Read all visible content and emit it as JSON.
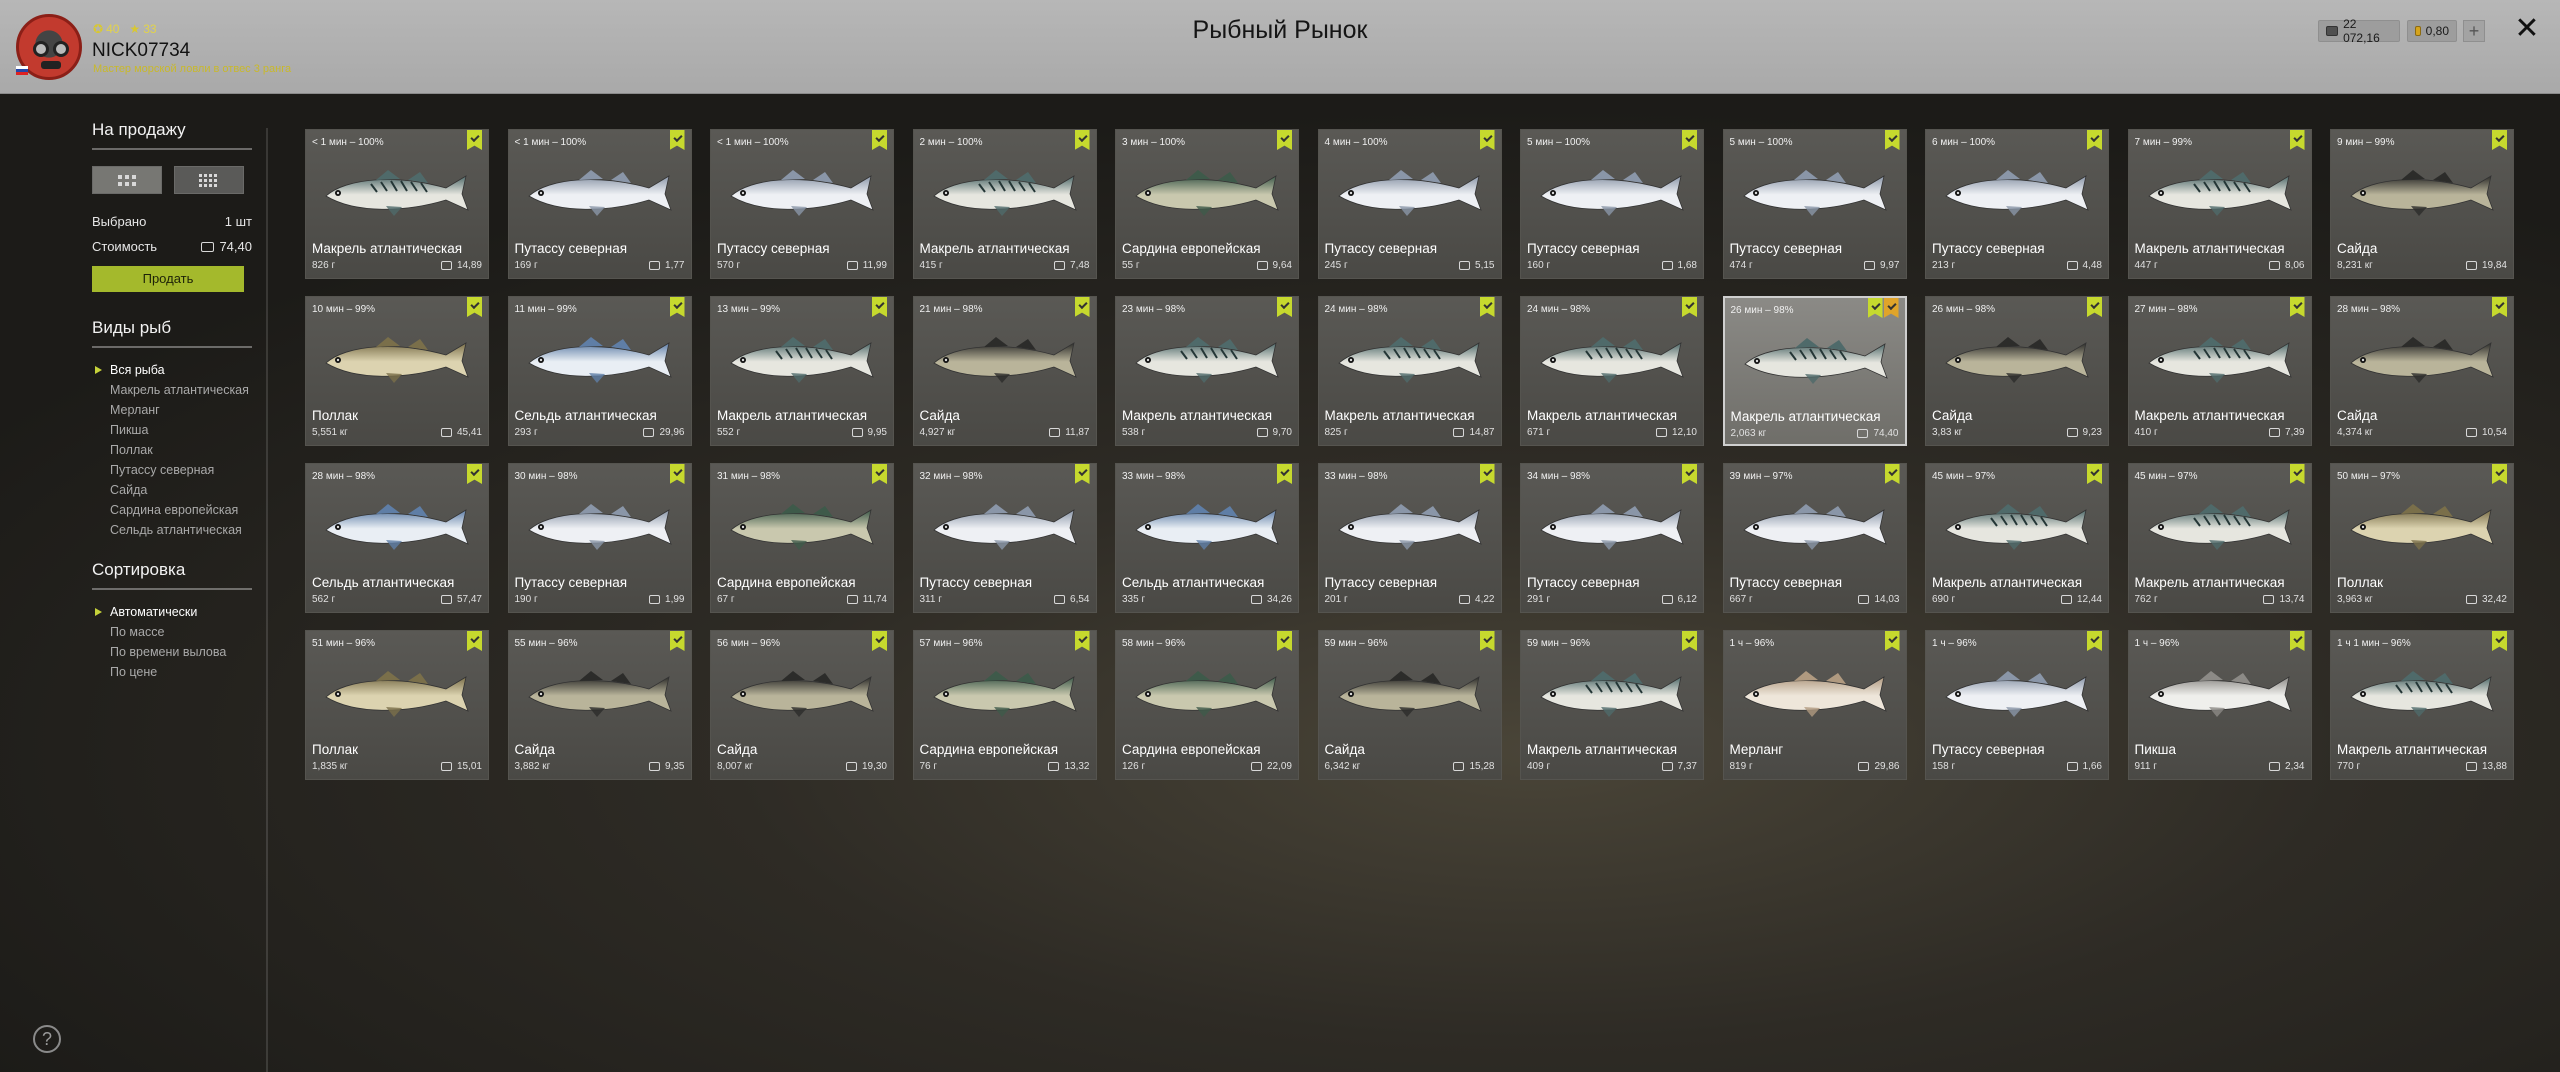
{
  "header": {
    "title": "Рыбный Рынок",
    "nick": "NICK07734",
    "rank": "Мастер морской ловли в отвес 3 ранга",
    "stat_level": "40",
    "stat_stars": "33",
    "silver": "22 072,16",
    "gold": "0,80",
    "plus": "+",
    "close": "✕"
  },
  "sidebar": {
    "sale_title": "На продажу",
    "selected_label": "Выбрано",
    "selected_value": "1 шт",
    "cost_label": "Стоимость",
    "cost_value": "74,40",
    "sell_button": "Продать",
    "species_title": "Виды рыб",
    "species": [
      "Вся рыба",
      "Макрель атлантическая",
      "Мерланг",
      "Пикша",
      "Поллак",
      "Путассу северная",
      "Сайда",
      "Сардина европейская",
      "Сельдь атлантическая"
    ],
    "species_selected": 0,
    "sort_title": "Сортировка",
    "sort": [
      "Автоматически",
      "По массе",
      "По времени вылова",
      "По цене"
    ],
    "sort_selected": 0
  },
  "help": "?",
  "colors": {
    "accent": "#a4b92c",
    "flag": "#c6d92e",
    "header": "#b0b0b0"
  },
  "fish": [
    {
      "time": "< 1 мин – 100%",
      "name": "Макрель атлантическая",
      "weight": "826 г",
      "price": "14,89",
      "kind": "mackerel"
    },
    {
      "time": "< 1 мин – 100%",
      "name": "Путассу северная",
      "weight": "169 г",
      "price": "1,77",
      "kind": "whiting"
    },
    {
      "time": "< 1 мин – 100%",
      "name": "Путассу северная",
      "weight": "570 г",
      "price": "11,99",
      "kind": "whiting"
    },
    {
      "time": "2 мин – 100%",
      "name": "Макрель атлантическая",
      "weight": "415 г",
      "price": "7,48",
      "kind": "mackerel"
    },
    {
      "time": "3 мин – 100%",
      "name": "Сардина европейская",
      "weight": "55 г",
      "price": "9,64",
      "kind": "sardine"
    },
    {
      "time": "4 мин – 100%",
      "name": "Путассу северная",
      "weight": "245 г",
      "price": "5,15",
      "kind": "whiting"
    },
    {
      "time": "5 мин – 100%",
      "name": "Путассу северная",
      "weight": "160 г",
      "price": "1,68",
      "kind": "whiting"
    },
    {
      "time": "5 мин – 100%",
      "name": "Путассу северная",
      "weight": "474 г",
      "price": "9,97",
      "kind": "whiting"
    },
    {
      "time": "6 мин – 100%",
      "name": "Путассу северная",
      "weight": "213 г",
      "price": "4,48",
      "kind": "whiting"
    },
    {
      "time": "7 мин – 99%",
      "name": "Макрель атлантическая",
      "weight": "447 г",
      "price": "8,06",
      "kind": "mackerel"
    },
    {
      "time": "9 мин – 99%",
      "name": "Сайда",
      "weight": "8,231 кг",
      "price": "19,84",
      "kind": "saithe"
    },
    {
      "time": "10 мин – 99%",
      "name": "Поллак",
      "weight": "5,551 кг",
      "price": "45,41",
      "kind": "pollack"
    },
    {
      "time": "11 мин – 99%",
      "name": "Сельдь атлантическая",
      "weight": "293 г",
      "price": "29,96",
      "kind": "herring"
    },
    {
      "time": "13 мин – 99%",
      "name": "Макрель атлантическая",
      "weight": "552 г",
      "price": "9,95",
      "kind": "mackerel"
    },
    {
      "time": "21 мин – 98%",
      "name": "Сайда",
      "weight": "4,927 кг",
      "price": "11,87",
      "kind": "saithe"
    },
    {
      "time": "23 мин – 98%",
      "name": "Макрель атлантическая",
      "weight": "538 г",
      "price": "9,70",
      "kind": "mackerel"
    },
    {
      "time": "24 мин – 98%",
      "name": "Макрель атлантическая",
      "weight": "825 г",
      "price": "14,87",
      "kind": "mackerel"
    },
    {
      "time": "24 мин – 98%",
      "name": "Макрель атлантическая",
      "weight": "671 г",
      "price": "12,10",
      "kind": "mackerel"
    },
    {
      "time": "26 мин – 98%",
      "name": "Макрель атлантическая",
      "weight": "2,063 кг",
      "price": "74,40",
      "kind": "mackerel",
      "selected": true
    },
    {
      "time": "26 мин – 98%",
      "name": "Сайда",
      "weight": "3,83 кг",
      "price": "9,23",
      "kind": "saithe"
    },
    {
      "time": "27 мин – 98%",
      "name": "Макрель атлантическая",
      "weight": "410 г",
      "price": "7,39",
      "kind": "mackerel"
    },
    {
      "time": "28 мин – 98%",
      "name": "Сайда",
      "weight": "4,374 кг",
      "price": "10,54",
      "kind": "saithe"
    },
    {
      "time": "28 мин – 98%",
      "name": "Сельдь атлантическая",
      "weight": "562 г",
      "price": "57,47",
      "kind": "herring"
    },
    {
      "time": "30 мин – 98%",
      "name": "Путассу северная",
      "weight": "190 г",
      "price": "1,99",
      "kind": "whiting"
    },
    {
      "time": "31 мин – 98%",
      "name": "Сардина европейская",
      "weight": "67 г",
      "price": "11,74",
      "kind": "sardine"
    },
    {
      "time": "32 мин – 98%",
      "name": "Путассу северная",
      "weight": "311 г",
      "price": "6,54",
      "kind": "whiting"
    },
    {
      "time": "33 мин – 98%",
      "name": "Сельдь атлантическая",
      "weight": "335 г",
      "price": "34,26",
      "kind": "herring"
    },
    {
      "time": "33 мин – 98%",
      "name": "Путассу северная",
      "weight": "201 г",
      "price": "4,22",
      "kind": "whiting"
    },
    {
      "time": "34 мин – 98%",
      "name": "Путассу северная",
      "weight": "291 г",
      "price": "6,12",
      "kind": "whiting"
    },
    {
      "time": "39 мин – 97%",
      "name": "Путассу северная",
      "weight": "667 г",
      "price": "14,03",
      "kind": "whiting"
    },
    {
      "time": "45 мин – 97%",
      "name": "Макрель атлантическая",
      "weight": "690 г",
      "price": "12,44",
      "kind": "mackerel"
    },
    {
      "time": "45 мин – 97%",
      "name": "Макрель атлантическая",
      "weight": "762 г",
      "price": "13,74",
      "kind": "mackerel"
    },
    {
      "time": "50 мин – 97%",
      "name": "Поллак",
      "weight": "3,963 кг",
      "price": "32,42",
      "kind": "pollack"
    },
    {
      "time": "51 мин – 96%",
      "name": "Поллак",
      "weight": "1,835 кг",
      "price": "15,01",
      "kind": "pollack"
    },
    {
      "time": "55 мин – 96%",
      "name": "Сайда",
      "weight": "3,882 кг",
      "price": "9,35",
      "kind": "saithe"
    },
    {
      "time": "56 мин – 96%",
      "name": "Сайда",
      "weight": "8,007 кг",
      "price": "19,30",
      "kind": "saithe"
    },
    {
      "time": "57 мин – 96%",
      "name": "Сардина европейская",
      "weight": "76 г",
      "price": "13,32",
      "kind": "sardine"
    },
    {
      "time": "58 мин – 96%",
      "name": "Сардина европейская",
      "weight": "126 г",
      "price": "22,09",
      "kind": "sardine"
    },
    {
      "time": "59 мин – 96%",
      "name": "Сайда",
      "weight": "6,342 кг",
      "price": "15,28",
      "kind": "saithe"
    },
    {
      "time": "59 мин – 96%",
      "name": "Макрель атлантическая",
      "weight": "409 г",
      "price": "7,37",
      "kind": "mackerel"
    },
    {
      "time": "1 ч – 96%",
      "name": "Мерланг",
      "weight": "819 г",
      "price": "29,86",
      "kind": "merlang"
    },
    {
      "time": "1 ч – 96%",
      "name": "Путассу северная",
      "weight": "158 г",
      "price": "1,66",
      "kind": "whiting"
    },
    {
      "time": "1 ч – 96%",
      "name": "Пикша",
      "weight": "911 г",
      "price": "2,34",
      "kind": "haddock"
    },
    {
      "time": "1 ч 1 мин – 96%",
      "name": "Макрель атлантическая",
      "weight": "770 г",
      "price": "13,88",
      "kind": "mackerel"
    }
  ]
}
